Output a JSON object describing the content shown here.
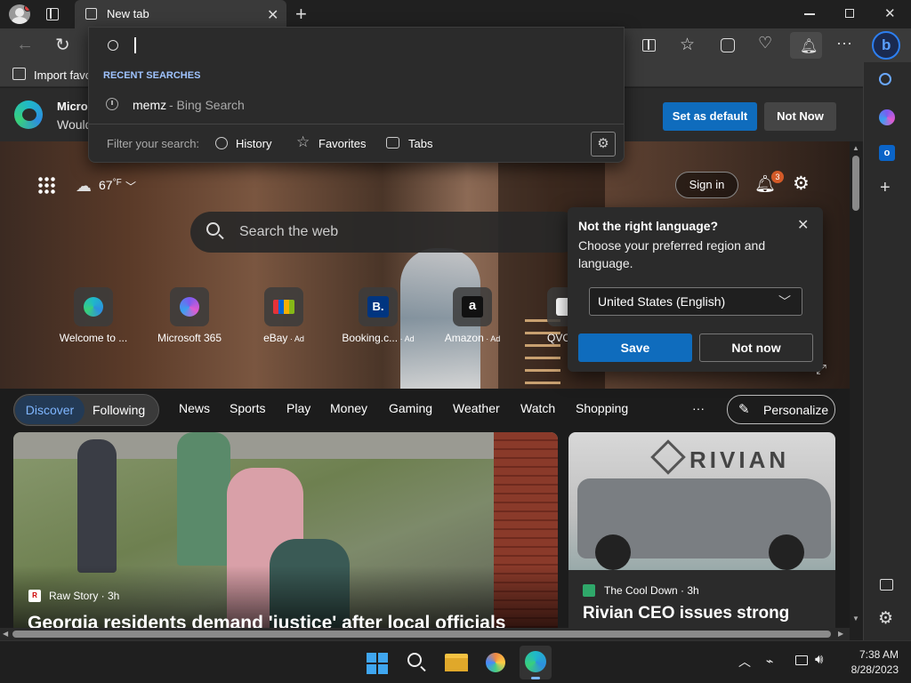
{
  "tab": {
    "title": "New tab"
  },
  "address": {
    "value": ""
  },
  "dropdown": {
    "section_label": "RECENT SEARCHES",
    "recent": [
      {
        "query": "memz",
        "source": " - Bing Search"
      }
    ],
    "filter_label": "Filter your search:",
    "filters": [
      "History",
      "Favorites",
      "Tabs"
    ]
  },
  "favbar": {
    "import_label": "Import favo"
  },
  "banner": {
    "title": "Micros",
    "subtitle": "Would",
    "set_default": "Set as default",
    "not_now": "Not Now"
  },
  "weather": {
    "temp": "67",
    "unit": "°F"
  },
  "header": {
    "sign_in": "Sign in",
    "notif_count": "3"
  },
  "search": {
    "placeholder": "Search the web"
  },
  "tiles": [
    {
      "label": "Welcome to ...",
      "ad": ""
    },
    {
      "label": "Microsoft 365",
      "ad": ""
    },
    {
      "label": "eBay",
      "ad": " · Ad"
    },
    {
      "label": "Booking.c...",
      "ad": " · Ad"
    },
    {
      "label": "Amazon",
      "ad": " · Ad"
    },
    {
      "label": "QVC",
      "ad": ""
    }
  ],
  "language_popup": {
    "title": "Not the right language?",
    "body": "Choose your preferred region and language.",
    "selected": "United States (English)",
    "save": "Save",
    "not_now": "Not now"
  },
  "feed_nav": {
    "discover": "Discover",
    "following": "Following",
    "items": [
      "News",
      "Sports",
      "Play",
      "Money",
      "Gaming",
      "Weather",
      "Watch",
      "Shopping"
    ],
    "more": "···",
    "personalize": "Personalize"
  },
  "cards": [
    {
      "source": "Raw Story · 3h",
      "headline": "Georgia residents demand 'justice' after local officials"
    },
    {
      "source": "The Cool Down · 3h",
      "headline": "Rivian CEO issues strong",
      "sign_text": "RIVIAN"
    }
  ],
  "clock": {
    "time": "7:38 AM",
    "date": "8/28/2023"
  },
  "colors": {
    "accent": "#0f6cbd",
    "popup_bg": "#2b2b2b",
    "toolbar_bg": "#3a3a3a"
  }
}
